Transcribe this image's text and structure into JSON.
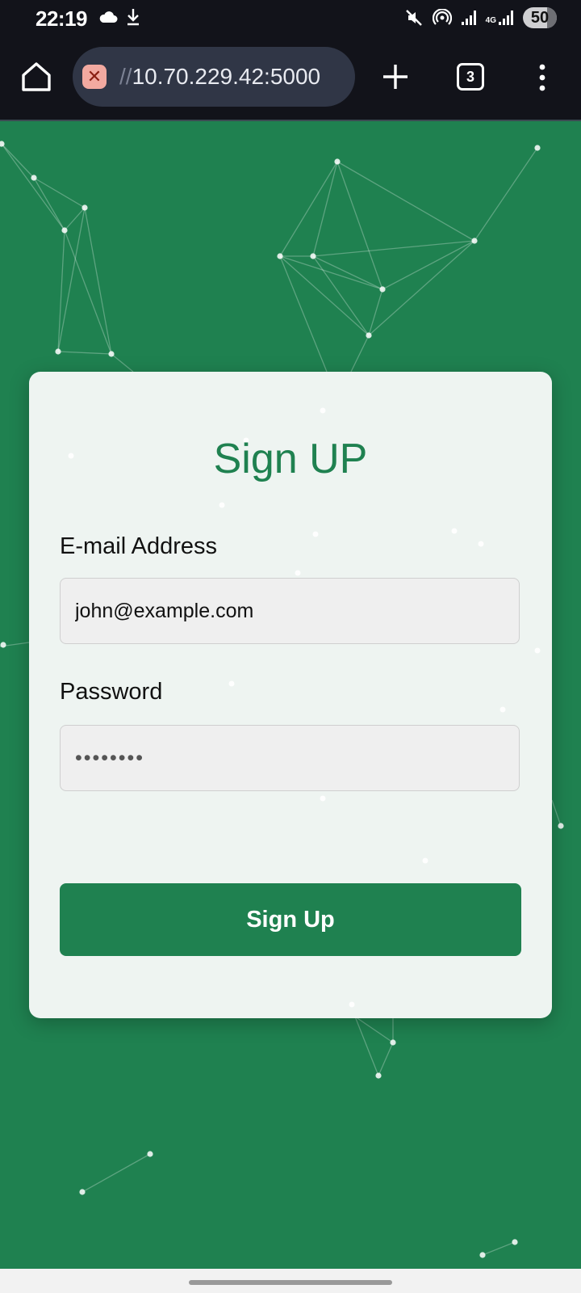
{
  "status_bar": {
    "time": "22:19",
    "network_type": "4G",
    "battery_level": "50",
    "icons": [
      "cloud-icon",
      "download-icon",
      "mute-icon",
      "hotspot-icon",
      "signal-icon",
      "signal-icon",
      "battery-icon"
    ]
  },
  "browser": {
    "url_scheme": "//",
    "url_host": "10.70.229.42:5000",
    "tab_count": "3",
    "icons": [
      "home-icon",
      "not-secure-icon",
      "new-tab-icon",
      "tabs-icon",
      "menu-icon"
    ]
  },
  "form": {
    "title": "Sign UP",
    "email_label": "E-mail Address",
    "email_value": "john@example.com",
    "password_label": "Password",
    "password_placeholder": "••••••••",
    "submit_label": "Sign Up"
  },
  "colors": {
    "background": "#1f8150",
    "accent": "#1f8150",
    "card": "#f5f8f7",
    "browser_bar": "#12131a"
  }
}
